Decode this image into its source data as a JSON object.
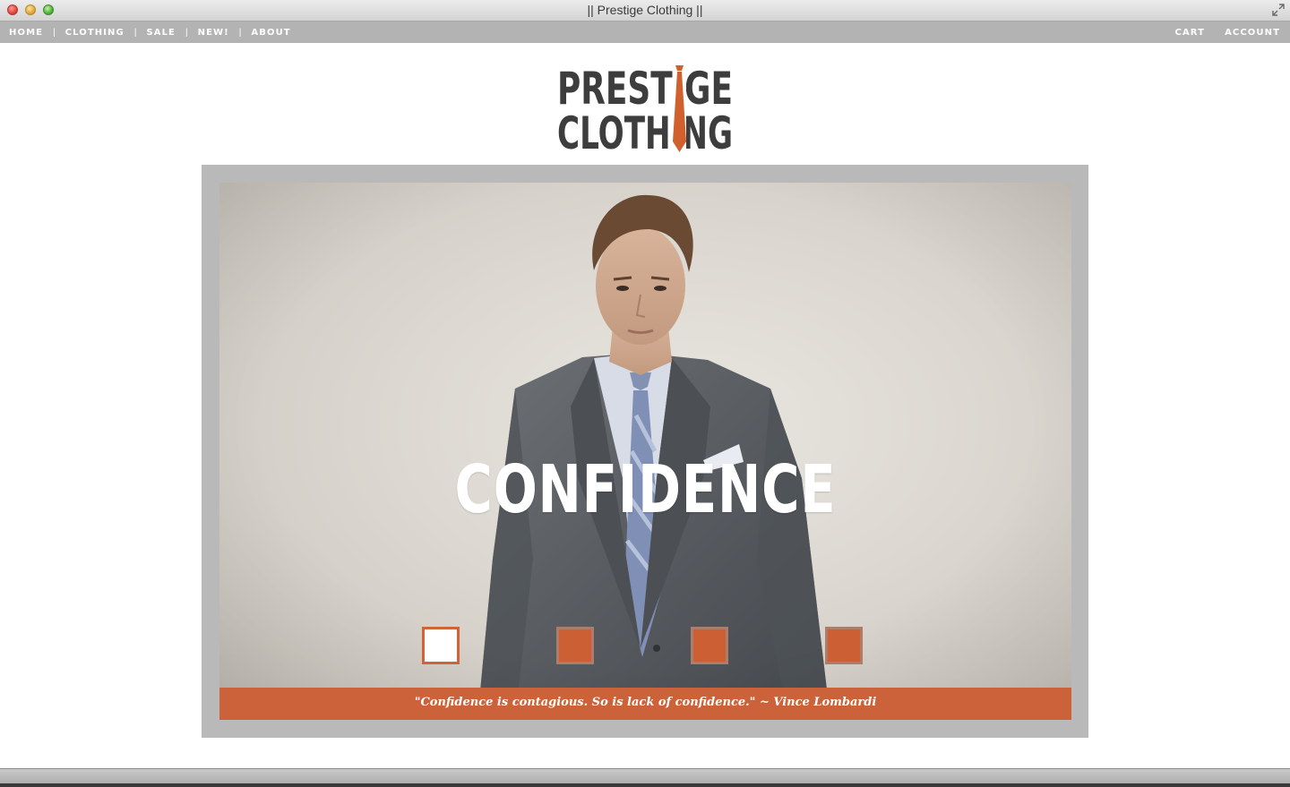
{
  "window": {
    "title": "|| Prestige Clothing ||"
  },
  "nav": {
    "left_items": [
      {
        "label": "HOME"
      },
      {
        "label": "CLOTHING"
      },
      {
        "label": "SALE"
      },
      {
        "label": "NEW!"
      },
      {
        "label": "ABOUT"
      }
    ],
    "separator": "|",
    "right_items": [
      {
        "label": "CART"
      },
      {
        "label": "ACCOUNT"
      }
    ]
  },
  "logo": {
    "line1": "PRESTIGE",
    "line2": "CLOTHING",
    "accent_color": "#d0612f",
    "text_color": "#3d3d3d"
  },
  "hero": {
    "heading": "CONFIDENCE",
    "quote": "\"Confidence is contagious. So is lack of confidence.\" ~ Vince Lombardi",
    "slides": 4,
    "active_slide": 1,
    "accent_color": "#cc6239"
  }
}
